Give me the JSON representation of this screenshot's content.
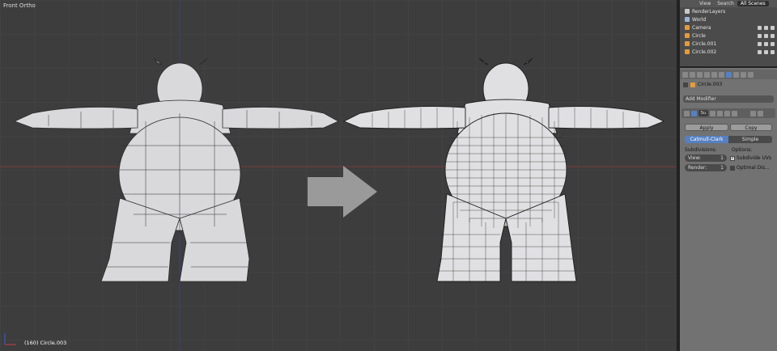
{
  "viewport": {
    "view_label": "Front Ortho",
    "object_label": "(160) Circle.003"
  },
  "outliner": {
    "tabs": [
      "View",
      "Search",
      "All Scenes"
    ],
    "rows": [
      {
        "name": "RenderLayers",
        "color": "#c9c9c9"
      },
      {
        "name": "World",
        "color": "#9ab6d6"
      },
      {
        "name": "Camera",
        "color": "#e59b3b"
      },
      {
        "name": "Circle",
        "color": "#e59b3b"
      },
      {
        "name": "Circle.001",
        "color": "#e59b3b"
      },
      {
        "name": "Circle.002",
        "color": "#e59b3b"
      }
    ]
  },
  "properties": {
    "object_name": "Circle.003",
    "add_modifier": "Add Modifier",
    "modifier_short": "Su",
    "apply": "Apply",
    "copy": "Copy",
    "mode_a": "Catmull-Clark",
    "mode_b": "Simple",
    "subdivisions_label": "Subdivisions:",
    "options_label": "Options:",
    "view_label": "View:",
    "view_value": "1",
    "render_label": "Render:",
    "render_value": "1",
    "subdivide_uvs": "Subdivide UVs",
    "optimal_display": "Optimal Dis..."
  }
}
